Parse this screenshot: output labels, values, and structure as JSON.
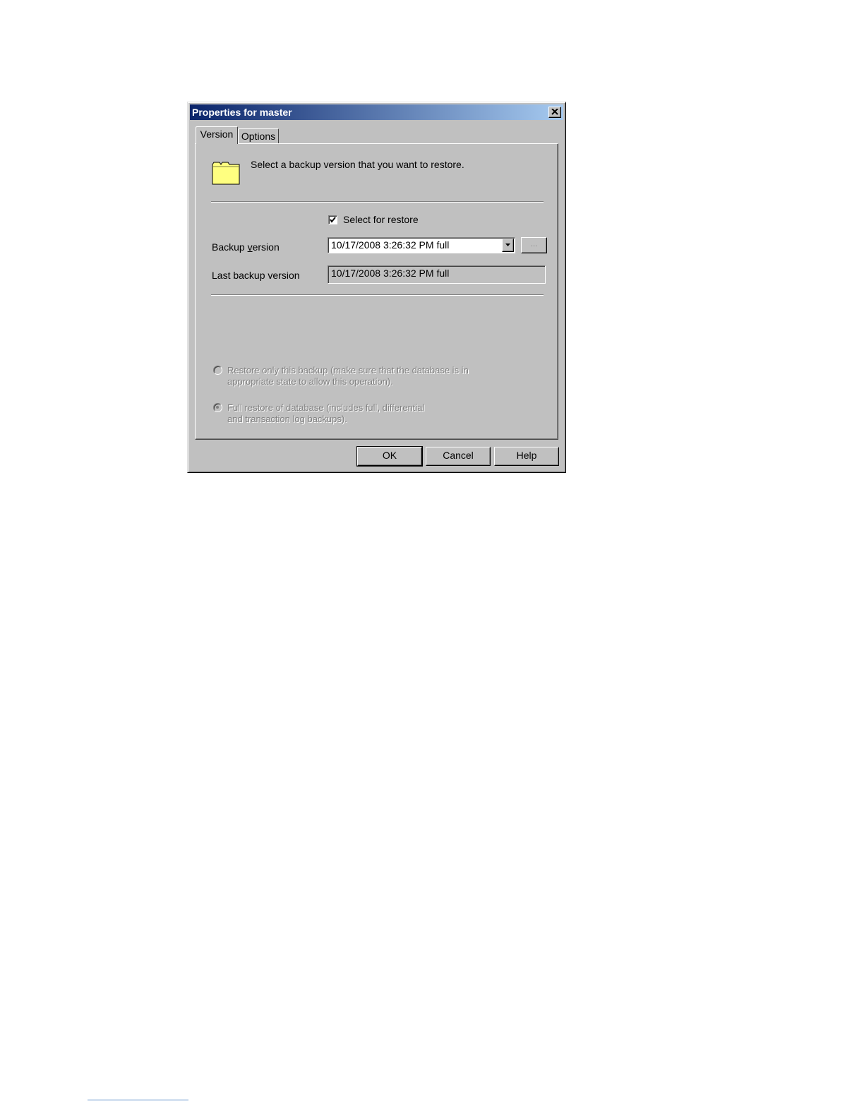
{
  "dialog": {
    "title": "Properties for master",
    "close_icon": "close-icon",
    "tabs": [
      {
        "label": "Version",
        "active": true
      },
      {
        "label": "Options",
        "active": false
      }
    ],
    "header_icon": "folder-icon",
    "header_text": "Select a backup version that you want to restore.",
    "select_for_restore": {
      "label": "Select for restore",
      "checked": true
    },
    "backup_version": {
      "label_prefix": "Backup ",
      "label_mnemonic": "v",
      "label_suffix": "ersion",
      "value": "10/17/2008 3:26:32 PM full",
      "browse_label": "..."
    },
    "last_backup_version": {
      "label": "Last backup version",
      "value": "10/17/2008 3:26:32 PM full"
    },
    "options": [
      {
        "line1": "Restore only this backup (make sure that the database is in",
        "line2": "appropriate state to allow this operation).",
        "selected": false,
        "enabled": false
      },
      {
        "line1": "Full restore of database (includes full, differential",
        "line2": "and transaction log backups).",
        "selected": true,
        "enabled": false
      }
    ],
    "buttons": {
      "ok": "OK",
      "cancel": "Cancel",
      "help": "Help"
    },
    "colors": {
      "titlebar_start": "#0a246a",
      "titlebar_end": "#a6caf0",
      "face": "#c0c0c0",
      "folder": "#ffff80"
    }
  }
}
